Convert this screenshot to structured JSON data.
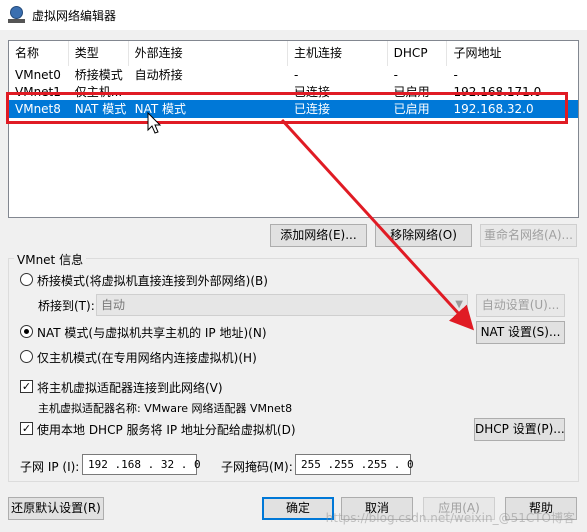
{
  "window": {
    "title": "虚拟网络编辑器"
  },
  "list": {
    "columns": [
      "名称",
      "类型",
      "外部连接",
      "主机连接",
      "DHCP",
      "子网地址"
    ],
    "rows": [
      [
        "VMnet0",
        "桥接模式",
        "自动桥接",
        "-",
        "-",
        "-"
      ],
      [
        "VMnet1",
        "仅主机...",
        "-",
        "已连接",
        "已启用",
        "192.168.171.0"
      ],
      [
        "VMnet8",
        "NAT 模式",
        "NAT 模式",
        "已连接",
        "已启用",
        "192.168.32.0"
      ]
    ],
    "selected_index": 2
  },
  "list_buttons": {
    "add": "添加网络(E)...",
    "remove": "移除网络(O)",
    "rename": "重命名网络(A)..."
  },
  "vmnet_info": {
    "group_label": "VMnet 信息",
    "bridged_label": "桥接模式(将虚拟机直接连接到外部网络)(B)",
    "bridged_to_label": "桥接到(T):",
    "bridged_to_value": "自动",
    "auto_settings": "自动设置(U)...",
    "nat_label": "NAT 模式(与虚拟机共享主机的 IP 地址)(N)",
    "nat_settings": "NAT 设置(S)...",
    "hostonly_label": "仅主机模式(在专用网络内连接虚拟机)(H)",
    "connect_adapter_label": "将主机虚拟适配器连接到此网络(V)",
    "adapter_name": "主机虚拟适配器名称: VMware 网络适配器 VMnet8",
    "dhcp_label": "使用本地 DHCP 服务将 IP 地址分配给虚拟机(D)",
    "dhcp_settings": "DHCP 设置(P)...",
    "subnet_ip_label": "子网 IP (I):",
    "subnet_ip_value": "192 .168 . 32 . 0",
    "subnet_mask_label": "子网掩码(M):",
    "subnet_mask_value": "255 .255 .255 . 0"
  },
  "footer": {
    "restore": "还原默认设置(R)",
    "ok": "确定",
    "cancel": "取消",
    "apply": "应用(A)",
    "help": "帮助"
  },
  "watermark": "https://blog.csdn.net/weixin_@51CTO博客",
  "colors": {
    "selection": "#0078d7",
    "annotation": "#e01b24"
  },
  "icons": {
    "title": "network-globe-icon",
    "cursor": "mouse-cursor-icon"
  }
}
